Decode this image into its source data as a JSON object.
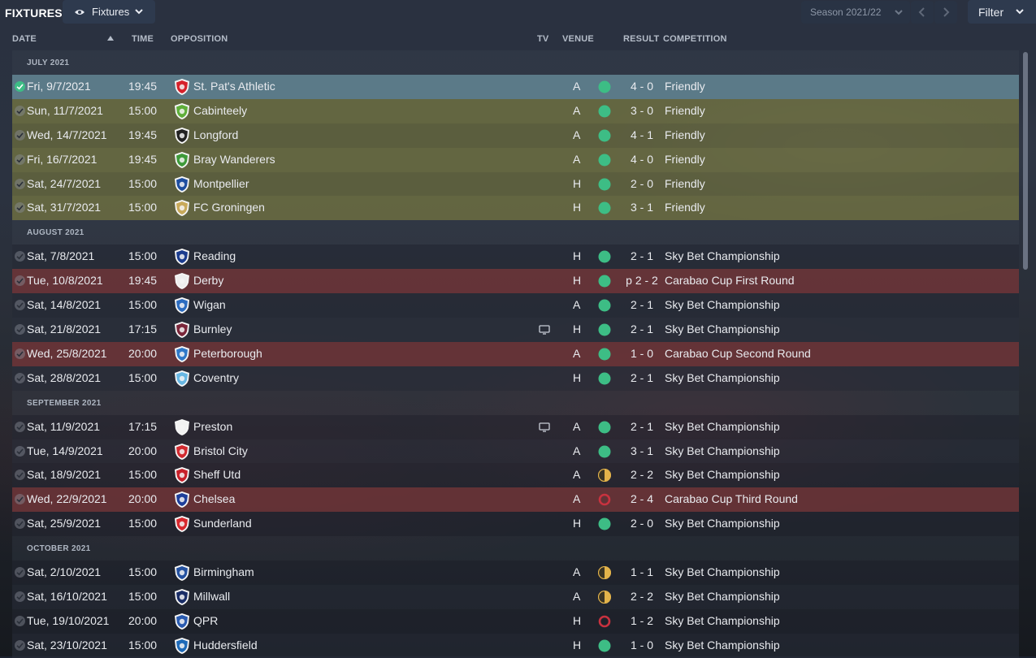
{
  "app": {
    "title": "FIXTURES",
    "view_dropdown": "Fixtures",
    "season_dropdown": "Season 2021/22",
    "filter_label": "Filter"
  },
  "columns": {
    "date": "DATE",
    "time": "TIME",
    "opposition": "OPPOSITION",
    "tv": "TV",
    "venue": "VENUE",
    "result": "RESULT",
    "competition": "COMPETITION"
  },
  "colors": {
    "win": "#3dbd85",
    "draw": "#e3b34a",
    "loss": "#c8323f",
    "friendly_row": "#66683e",
    "cup_row": "#6c3438",
    "selected_row": "#5b7a88"
  },
  "months": [
    {
      "label": "JULY 2021",
      "fixtures": [
        {
          "date": "Fri, 9/7/2021",
          "time": "19:45",
          "team": "St. Pat's Athletic",
          "crest": "red-crest-icon",
          "crest_color": "#d6212b",
          "tv": false,
          "venue": "A",
          "outcome": "win",
          "result": "4 - 0",
          "competition": "Friendly",
          "type": "selected"
        },
        {
          "date": "Sun, 11/7/2021",
          "time": "15:00",
          "team": "Cabinteely",
          "crest": "green-crest-icon",
          "crest_color": "#5fae3a",
          "tv": false,
          "venue": "A",
          "outcome": "win",
          "result": "3 - 0",
          "competition": "Friendly",
          "type": "friendly"
        },
        {
          "date": "Wed, 14/7/2021",
          "time": "19:45",
          "team": "Longford",
          "crest": "black-white-crest-icon",
          "crest_color": "#222222",
          "tv": false,
          "venue": "A",
          "outcome": "win",
          "result": "4 - 1",
          "competition": "Friendly",
          "type": "friendly"
        },
        {
          "date": "Fri, 16/7/2021",
          "time": "19:45",
          "team": "Bray Wanderers",
          "crest": "green-crest-icon",
          "crest_color": "#3e9a3a",
          "tv": false,
          "venue": "A",
          "outcome": "win",
          "result": "4 - 0",
          "competition": "Friendly",
          "type": "friendly"
        },
        {
          "date": "Sat, 24/7/2021",
          "time": "15:00",
          "team": "Montpellier",
          "crest": "blue-crest-icon",
          "crest_color": "#1e4ea0",
          "tv": false,
          "venue": "H",
          "outcome": "win",
          "result": "2 - 0",
          "competition": "Friendly",
          "type": "friendly"
        },
        {
          "date": "Sat, 31/7/2021",
          "time": "15:00",
          "team": "FC Groningen",
          "crest": "gold-crest-icon",
          "crest_color": "#c8a95a",
          "tv": false,
          "venue": "H",
          "outcome": "win",
          "result": "3 - 1",
          "competition": "Friendly",
          "type": "friendly"
        }
      ]
    },
    {
      "label": "AUGUST 2021",
      "fixtures": [
        {
          "date": "Sat, 7/8/2021",
          "time": "15:00",
          "team": "Reading",
          "crest": "blue-crest-icon",
          "crest_color": "#1b3c8e",
          "tv": false,
          "venue": "H",
          "outcome": "win",
          "result": "2 - 1",
          "competition": "Sky Bet Championship",
          "type": "plain"
        },
        {
          "date": "Tue, 10/8/2021",
          "time": "19:45",
          "team": "Derby",
          "crest": "ram-crest-icon",
          "crest_color": "#eeeeee",
          "tv": false,
          "venue": "H",
          "outcome": "win",
          "result": "p 2 - 2",
          "competition": "Carabao Cup First Round",
          "type": "cup"
        },
        {
          "date": "Sat, 14/8/2021",
          "time": "15:00",
          "team": "Wigan",
          "crest": "blue-crest-icon",
          "crest_color": "#2c6cc0",
          "tv": false,
          "venue": "A",
          "outcome": "win",
          "result": "2 - 1",
          "competition": "Sky Bet Championship",
          "type": "plain"
        },
        {
          "date": "Sat, 21/8/2021",
          "time": "17:15",
          "team": "Burnley",
          "crest": "claret-crest-icon",
          "crest_color": "#7a263a",
          "tv": true,
          "venue": "H",
          "outcome": "win",
          "result": "2 - 1",
          "competition": "Sky Bet Championship",
          "type": "plain"
        },
        {
          "date": "Wed, 25/8/2021",
          "time": "20:00",
          "team": "Peterborough",
          "crest": "blue-crest-icon",
          "crest_color": "#2f78c8",
          "tv": false,
          "venue": "A",
          "outcome": "win",
          "result": "1 - 0",
          "competition": "Carabao Cup Second Round",
          "type": "cup"
        },
        {
          "date": "Sat, 28/8/2021",
          "time": "15:00",
          "team": "Coventry",
          "crest": "sky-blue-crest-icon",
          "crest_color": "#67b7e3",
          "tv": false,
          "venue": "H",
          "outcome": "win",
          "result": "2 - 1",
          "competition": "Sky Bet Championship",
          "type": "plain"
        }
      ]
    },
    {
      "label": "SEPTEMBER 2021",
      "fixtures": [
        {
          "date": "Sat, 11/9/2021",
          "time": "17:15",
          "team": "Preston",
          "crest": "white-crest-icon",
          "crest_color": "#f2f2f2",
          "tv": true,
          "venue": "A",
          "outcome": "win",
          "result": "2 - 1",
          "competition": "Sky Bet Championship",
          "type": "plain"
        },
        {
          "date": "Tue, 14/9/2021",
          "time": "20:00",
          "team": "Bristol City",
          "crest": "red-crest-icon",
          "crest_color": "#d12a30",
          "tv": false,
          "venue": "A",
          "outcome": "win",
          "result": "3 - 1",
          "competition": "Sky Bet Championship",
          "type": "plain"
        },
        {
          "date": "Sat, 18/9/2021",
          "time": "15:00",
          "team": "Sheff Utd",
          "crest": "red-crest-icon",
          "crest_color": "#c8202a",
          "tv": false,
          "venue": "A",
          "outcome": "draw",
          "result": "2 - 2",
          "competition": "Sky Bet Championship",
          "type": "plain"
        },
        {
          "date": "Wed, 22/9/2021",
          "time": "20:00",
          "team": "Chelsea",
          "crest": "blue-crest-icon",
          "crest_color": "#1e3f9a",
          "tv": false,
          "venue": "A",
          "outcome": "loss",
          "result": "2 - 4",
          "competition": "Carabao Cup Third Round",
          "type": "cup"
        },
        {
          "date": "Sat, 25/9/2021",
          "time": "15:00",
          "team": "Sunderland",
          "crest": "red-crest-icon",
          "crest_color": "#d8282e",
          "tv": false,
          "venue": "H",
          "outcome": "win",
          "result": "2 - 0",
          "competition": "Sky Bet Championship",
          "type": "plain"
        }
      ]
    },
    {
      "label": "OCTOBER 2021",
      "fixtures": [
        {
          "date": "Sat, 2/10/2021",
          "time": "15:00",
          "team": "Birmingham",
          "crest": "blue-crest-icon",
          "crest_color": "#2451a0",
          "tv": false,
          "venue": "A",
          "outcome": "draw",
          "result": "1 - 1",
          "competition": "Sky Bet Championship",
          "type": "plain"
        },
        {
          "date": "Sat, 16/10/2021",
          "time": "15:00",
          "team": "Millwall",
          "crest": "navy-crest-icon",
          "crest_color": "#1a2d66",
          "tv": false,
          "venue": "A",
          "outcome": "draw",
          "result": "2 - 2",
          "competition": "Sky Bet Championship",
          "type": "plain"
        },
        {
          "date": "Tue, 19/10/2021",
          "time": "20:00",
          "team": "QPR",
          "crest": "blue-crest-icon",
          "crest_color": "#2a5bb0",
          "tv": false,
          "venue": "H",
          "outcome": "loss",
          "result": "1 - 2",
          "competition": "Sky Bet Championship",
          "type": "plain"
        },
        {
          "date": "Sat, 23/10/2021",
          "time": "15:00",
          "team": "Huddersfield",
          "crest": "blue-crest-icon",
          "crest_color": "#1e6ab8",
          "tv": false,
          "venue": "H",
          "outcome": "win",
          "result": "1 - 0",
          "competition": "Sky Bet Championship",
          "type": "plain"
        }
      ]
    }
  ]
}
